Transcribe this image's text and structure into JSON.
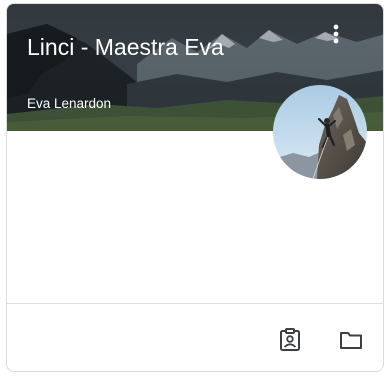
{
  "class_card": {
    "title": "Linci - Maestra Eva",
    "teacher": "Eva Lenardon",
    "header_image": "mountain-landscape",
    "avatar_image": "rock-climber-photo"
  },
  "menu": {
    "icon": "more-vert-icon"
  },
  "footer": {
    "actions": [
      {
        "icon": "assignment-ind-icon"
      },
      {
        "icon": "folder-icon"
      }
    ]
  },
  "colors": {
    "card_border": "#dadce0",
    "title_text": "#ffffff",
    "footer_icon": "#3c4043"
  }
}
